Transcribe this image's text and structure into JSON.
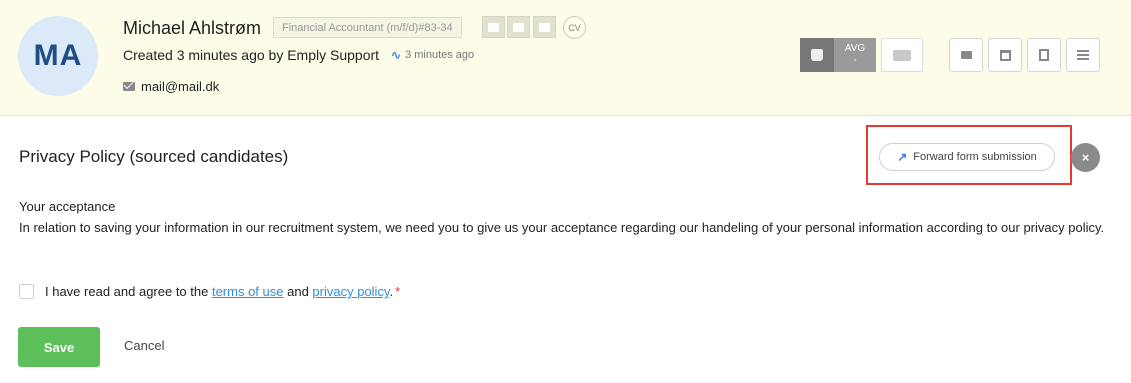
{
  "candidate": {
    "initials": "MA",
    "name": "Michael Ahlstrøm",
    "job": "Financial Accountant (m/f/d)#83-34",
    "cv_label": "CV",
    "created": "Created 3 minutes ago by Emply Support",
    "activity": "3 minutes ago",
    "email": "mail@mail.dk"
  },
  "rating": {
    "avg_label": "AVG",
    "avg_value": "-"
  },
  "form": {
    "title": "Privacy Policy (sourced candidates)",
    "forward_label": "Forward form submission",
    "close_glyph": "×",
    "section_label": "Your acceptance",
    "section_text": "In relation to saving your information in our recruitment system, we need you to give us your acceptance regarding our handeling of your personal information according to our privacy policy.",
    "agree_prefix": "I have read and agree to the ",
    "terms_link": "terms of use",
    "agree_and": " and ",
    "privacy_link": "privacy policy",
    "agree_suffix": ".",
    "required_mark": "*",
    "save_label": "Save",
    "cancel_label": "Cancel"
  }
}
